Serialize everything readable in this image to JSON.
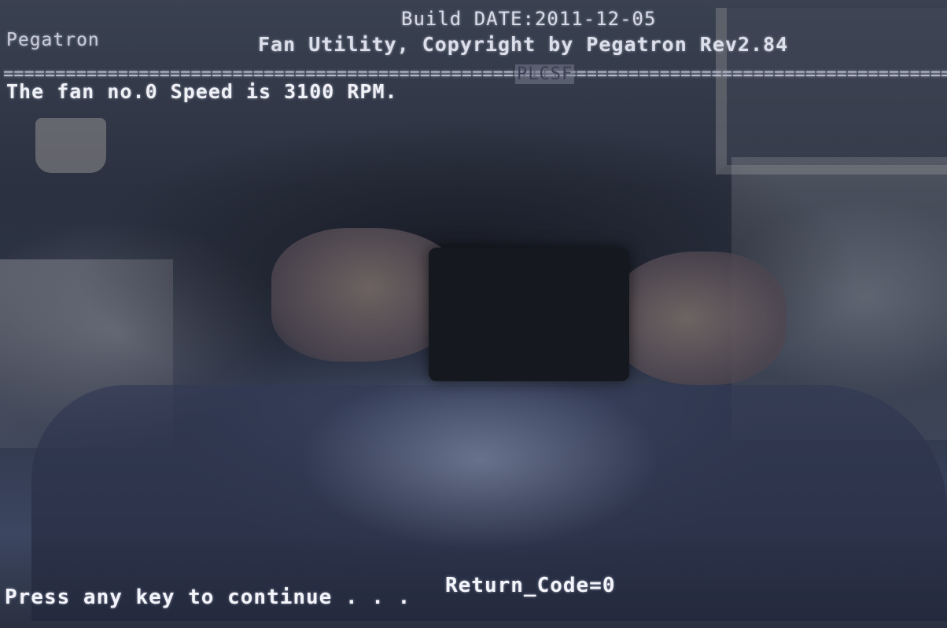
{
  "header": {
    "build_date": "Build DATE:2011-12-05",
    "vendor": "Pegatron",
    "title": "Fan Utility, Copyright by Pegatron Rev2.84",
    "separator": "================================================================================================================",
    "separator_label": "PLCSF"
  },
  "output": {
    "fan_speed_line": "The fan no.0 Speed is 3100 RPM."
  },
  "footer": {
    "return_code": "Return_Code=0",
    "prompt": "Press any key to continue . . ."
  }
}
